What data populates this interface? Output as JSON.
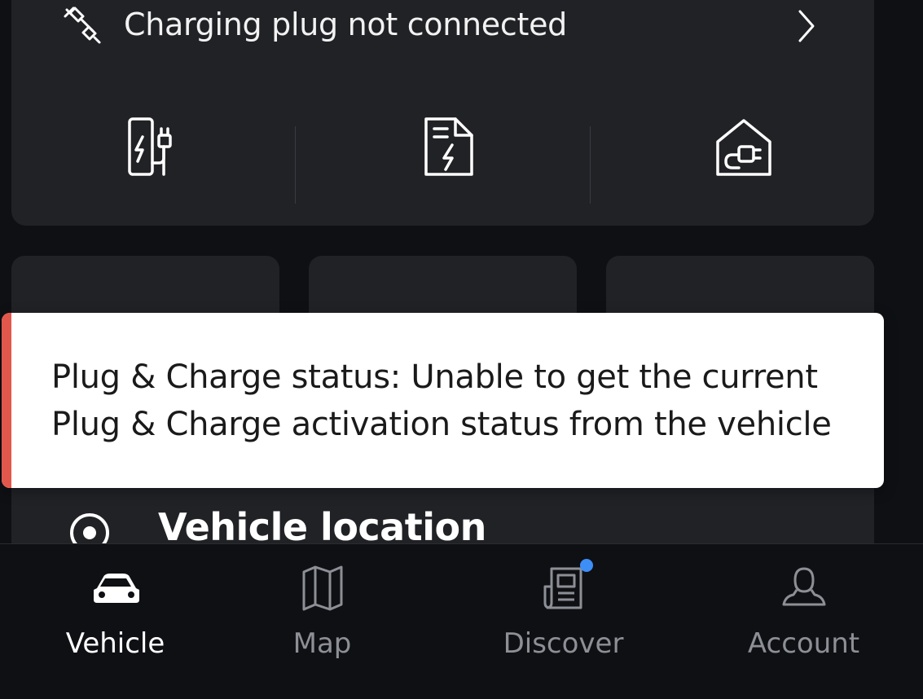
{
  "charging": {
    "status_text": "Charging plug not connected",
    "icons": [
      "plug-disconnected-icon",
      "chevron-right-icon"
    ]
  },
  "actions": [
    {
      "icon": "charging-station-icon"
    },
    {
      "icon": "charging-document-icon"
    },
    {
      "icon": "home-charging-icon"
    }
  ],
  "toast": {
    "message": "Plug & Charge status: Unable to get the current Plug & Charge activation status from the vehicle",
    "accent_color": "#e2574c"
  },
  "vehicle_location": {
    "label": "Vehicle location",
    "icon": "location-target-icon"
  },
  "nav": {
    "items": [
      {
        "label": "Vehicle",
        "icon": "car-icon",
        "active": true
      },
      {
        "label": "Map",
        "icon": "map-icon",
        "active": false
      },
      {
        "label": "Discover",
        "icon": "news-icon",
        "active": false,
        "badge": true
      },
      {
        "label": "Account",
        "icon": "user-icon",
        "active": false
      }
    ],
    "badge_color": "#3e8ef7"
  }
}
